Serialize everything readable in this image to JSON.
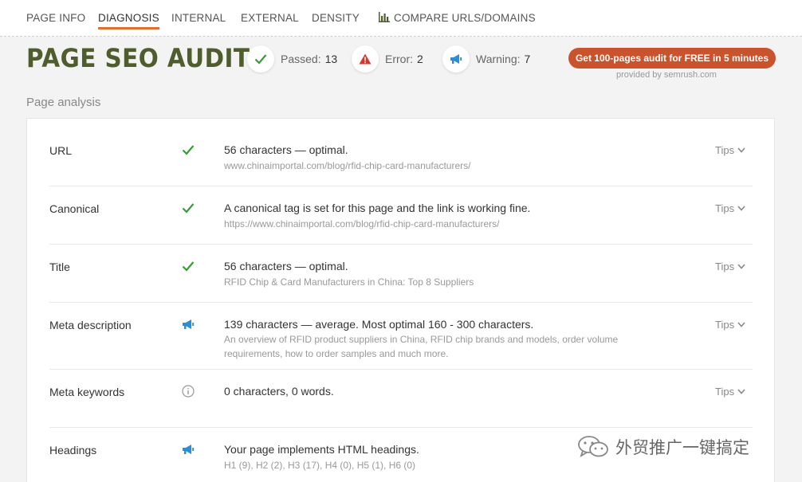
{
  "nav": {
    "tabs": [
      {
        "label": "PAGE INFO"
      },
      {
        "label": "DIAGNOSIS"
      },
      {
        "label": "INTERNAL"
      },
      {
        "label": "EXTERNAL"
      },
      {
        "label": "DENSITY"
      },
      {
        "label": "COMPARE URLS/DOMAINS",
        "icon": "bar-chart-icon"
      }
    ],
    "active": "DIAGNOSIS"
  },
  "header": {
    "title": "PAGE SEO AUDIT",
    "stats": [
      {
        "label": "Passed:",
        "value": "13",
        "icon": "check-icon"
      },
      {
        "label": "Error:",
        "value": "2",
        "icon": "error-triangle-icon"
      },
      {
        "label": "Warning:",
        "value": "7",
        "icon": "megaphone-icon"
      }
    ],
    "cta_label": "Get 100-pages audit for FREE in 5 minutes",
    "provided_by": "provided by  semrush.com"
  },
  "section_label": "Page analysis",
  "rows": [
    {
      "label": "URL",
      "status": "check-icon",
      "main": "56 characters — optimal.",
      "sub": "www.chinaimportal.com/blog/rfid-chip-card-manufacturers/",
      "tips": "Tips"
    },
    {
      "label": "Canonical",
      "status": "check-icon",
      "main": "A canonical tag is set for this page and the link is working fine.",
      "sub": "https://www.chinaimportal.com/blog/rfid-chip-card-manufacturers/",
      "tips": "Tips"
    },
    {
      "label": "Title",
      "status": "check-icon",
      "main": "56 characters — optimal.",
      "sub": "RFID Chip & Card Manufacturers in China: Top 8 Suppliers",
      "tips": "Tips"
    },
    {
      "label": "Meta description",
      "status": "megaphone-icon",
      "main": "139 characters — average. Most optimal 160 - 300 characters.",
      "sub": "An overview of RFID product suppliers in China, RFID chip brands and models, order volume requirements, how to order samples and much more.",
      "tips": "Tips"
    },
    {
      "label": "Meta keywords",
      "status": "info-icon",
      "main": "0 characters, 0 words.",
      "sub": "",
      "tips": "Tips"
    },
    {
      "label": "Headings",
      "status": "megaphone-icon",
      "main": "Your page implements HTML headings.",
      "sub": "H1 (9), H2 (2), H3 (17), H4 (0), H5 (1), H6 (0)",
      "tips": ""
    }
  ],
  "watermark": "外贸推广一键搞定",
  "colors": {
    "accent": "#e0702f",
    "title": "#4f5c2d",
    "cta": "#c9532c",
    "pass": "#3a9a3a",
    "error": "#d9362b",
    "warning": "#2b8fd6"
  }
}
